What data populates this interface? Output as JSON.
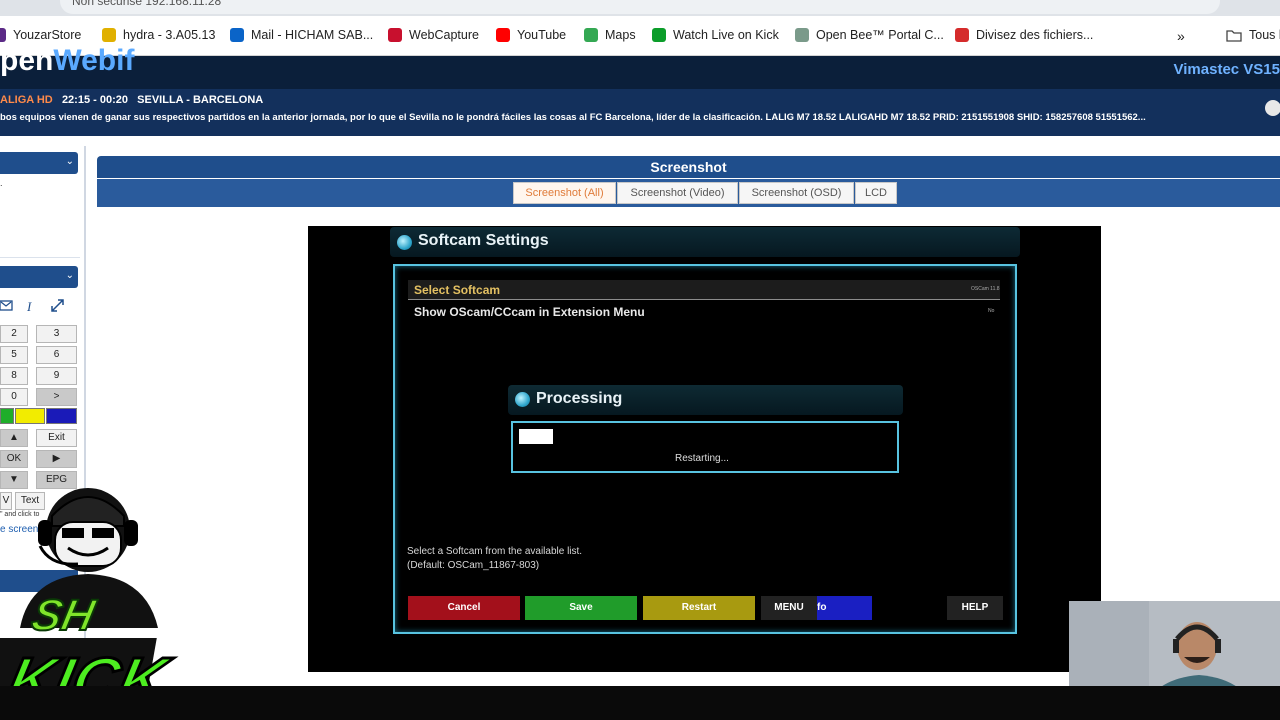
{
  "browser": {
    "url_fragment": "Non sécurisé   192.168.11.28",
    "bookmarks": [
      {
        "label": "YouzarStore",
        "icon": "youzarstore-icon",
        "color": "#5b2a86"
      },
      {
        "label": "hydra - 3.A05.13",
        "icon": "hydra-icon",
        "color": "#e0b000"
      },
      {
        "label": "Mail - HICHAM SAB...",
        "icon": "outlook-icon",
        "color": "#0a64c8"
      },
      {
        "label": "WebCapture",
        "icon": "webcapture-icon",
        "color": "#c8102e"
      },
      {
        "label": "YouTube",
        "icon": "youtube-icon",
        "color": "#ff0000"
      },
      {
        "label": "Maps",
        "icon": "maps-icon",
        "color": "#34a853"
      },
      {
        "label": "Watch Live on Kick",
        "icon": "kick-icon",
        "color": "#0b9d2a"
      },
      {
        "label": "Open Bee™ Portal C...",
        "icon": "openbee-icon",
        "color": "#7a9a8a"
      },
      {
        "label": "Divisez des fichiers...",
        "icon": "heart-icon",
        "color": "#d52b2b"
      }
    ],
    "more_label": "»",
    "all_bookmarks_label": "Tous l"
  },
  "header": {
    "logo_left": "pen",
    "logo_right": "Webif",
    "model": "Vimastec VS15"
  },
  "epg": {
    "channel": "ALIGA HD",
    "time": "22:15 - 00:20",
    "title": "SEVILLA - BARCELONA",
    "description": "bos equipos vienen de ganar sus respectivos partidos en la anterior jornada, por lo que el Sevilla no le pondrá fáciles las cosas al FC Barcelona, líder de la clasificación. LALIG M7 18.52 LALIGAHD M7 18.52 PRID: 2151551908 SHID: 158257608 51551562..."
  },
  "remote": {
    "keys": [
      {
        "label": "2"
      },
      {
        "label": "3"
      },
      {
        "label": "5"
      },
      {
        "label": "6"
      },
      {
        "label": "8"
      },
      {
        "label": "9"
      },
      {
        "label": "0"
      },
      {
        "label": ">"
      },
      {
        "label": "▲"
      },
      {
        "label": "Exit"
      },
      {
        "label": "OK"
      },
      {
        "label": "▶"
      },
      {
        "label": "▼"
      },
      {
        "label": "EPG"
      },
      {
        "label": "V"
      },
      {
        "label": "Text"
      }
    ],
    "hint1": "\" and click to",
    "hint2": "e screen"
  },
  "screenshot": {
    "title": "Screenshot",
    "tabs": [
      {
        "label": "Screenshot (All)"
      },
      {
        "label": "Screenshot (Video)"
      },
      {
        "label": "Screenshot (OSD)"
      },
      {
        "label": "LCD"
      }
    ]
  },
  "tv": {
    "window_title": "Softcam Settings",
    "rows": [
      {
        "label": "Select Softcam",
        "value": "OSCam 11.8"
      },
      {
        "label": "Show OScam/CCcam in Extension Menu",
        "value": "No"
      }
    ],
    "dialog_title": "Processing",
    "dialog_status": "Restarting...",
    "help_line1": "Select a Softcam from the available list.",
    "help_line2": "(Default: OSCam_11867-803)",
    "buttons": {
      "cancel": "Cancel",
      "save": "Save",
      "restart": "Restart",
      "menu": "MENU",
      "info": "fo",
      "help": "HELP"
    }
  },
  "overlay": {
    "logo_top": "SH",
    "logo_bottom": "KICK"
  }
}
